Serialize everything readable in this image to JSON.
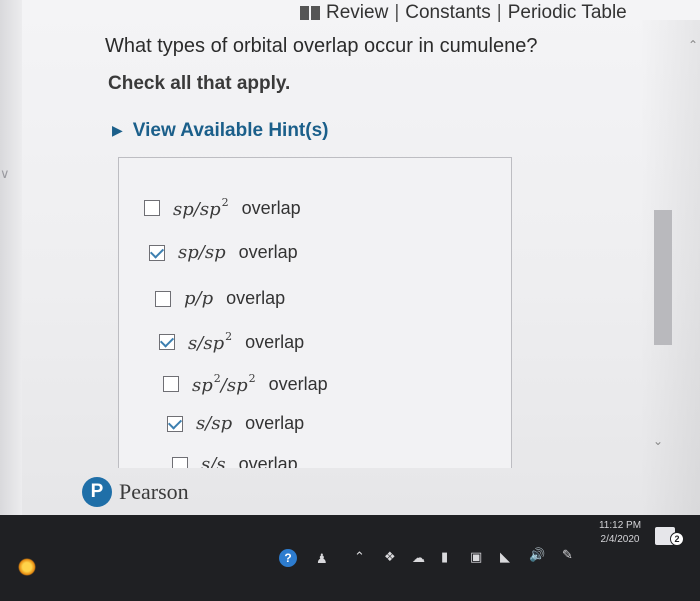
{
  "header": {
    "links": [
      "Review",
      "Constants",
      "Periodic Table"
    ],
    "separator": "|"
  },
  "question": {
    "text": "What types of orbital overlap occur in cumulene?",
    "instruction": "Check all that apply."
  },
  "hint": {
    "label": "View Available Hint(s)"
  },
  "options": [
    {
      "a": "sp",
      "a_sup": "",
      "b": "sp",
      "b_sup": "2",
      "suffix": "overlap",
      "checked": false
    },
    {
      "a": "sp",
      "a_sup": "",
      "b": "sp",
      "b_sup": "",
      "suffix": "overlap",
      "checked": true
    },
    {
      "a": "p",
      "a_sup": "",
      "b": "p",
      "b_sup": "",
      "suffix": "overlap",
      "checked": false
    },
    {
      "a": "s",
      "a_sup": "",
      "b": "sp",
      "b_sup": "2",
      "suffix": "overlap",
      "checked": true
    },
    {
      "a": "sp",
      "a_sup": "2",
      "b": "sp",
      "b_sup": "2",
      "suffix": "overlap",
      "checked": false
    },
    {
      "a": "s",
      "a_sup": "",
      "b": "sp",
      "b_sup": "",
      "suffix": "overlap",
      "checked": true
    },
    {
      "a": "s",
      "a_sup": "",
      "b": "s",
      "b_sup": "",
      "suffix": "overlap",
      "checked": false
    }
  ],
  "branding": {
    "logo_letter": "P",
    "name": "Pearson"
  },
  "taskbar": {
    "time": "11:12 PM",
    "date": "2/4/2020",
    "notification_count": "2",
    "help_glyph": "?"
  },
  "colors": {
    "accent": "#1b5f8a",
    "checkmark": "#3c7fb0",
    "pearson_blue": "#1f6fa8",
    "taskbar": "#1f2023"
  }
}
